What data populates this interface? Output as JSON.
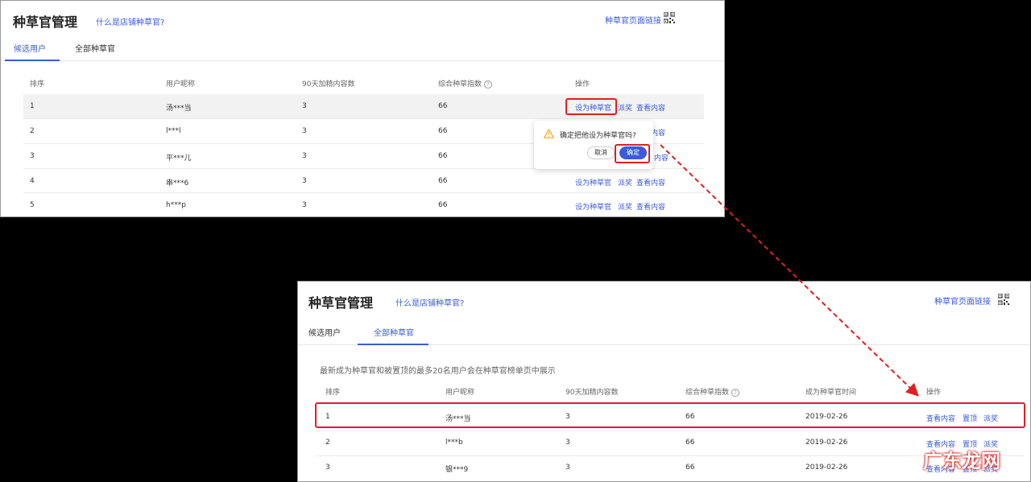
{
  "top": {
    "title": "种草官管理",
    "help_link": "什么是店铺种草官?",
    "page_link": "种草官页面链接",
    "tabs": [
      "候选用户",
      "全部种草官"
    ],
    "columns": [
      "排序",
      "用户昵称",
      "90天加精内容数",
      "综合种草指数",
      "操作"
    ],
    "rows": [
      {
        "rank": "1",
        "nick": "汤***当",
        "count": "3",
        "index": "66"
      },
      {
        "rank": "2",
        "nick": "l***l",
        "count": "3",
        "index": "66"
      },
      {
        "rank": "3",
        "nick": "平***儿",
        "count": "3",
        "index": "66"
      },
      {
        "rank": "4",
        "nick": "串***6",
        "count": "3",
        "index": "66"
      },
      {
        "rank": "5",
        "nick": "h***p",
        "count": "3",
        "index": "66"
      }
    ],
    "actions": {
      "set": "设为种草官",
      "award": "派奖",
      "view": "查看内容"
    },
    "partial_view": "内容",
    "partial_award": "派奖",
    "partial_view3": "内容",
    "popover": {
      "message": "确定把他设为种草官吗?",
      "cancel": "取消",
      "ok": "确定"
    }
  },
  "bottom": {
    "title": "种草官管理",
    "help_link": "什么是店铺种草官?",
    "page_link": "种草官页面链接",
    "tabs": [
      "候选用户",
      "全部种草官"
    ],
    "note": "最新成为种草官和被置顶的最多20名用户会在种草官榜单页中展示",
    "columns": [
      "排序",
      "用户昵称",
      "90天加精内容数",
      "综合种草指数",
      "成为种草官时间",
      "操作"
    ],
    "rows": [
      {
        "rank": "1",
        "nick": "汤***当",
        "count": "3",
        "index": "66",
        "date": "2019-02-26"
      },
      {
        "rank": "2",
        "nick": "l***b",
        "count": "3",
        "index": "66",
        "date": "2019-02-26"
      },
      {
        "rank": "3",
        "nick": "银***9",
        "count": "3",
        "index": "66",
        "date": "2019-02-26"
      }
    ],
    "actions": {
      "view": "查看内容",
      "pin": "置顶",
      "award": "派奖"
    }
  },
  "watermark": "广东龙网",
  "colors": {
    "accent": "#3b5bdb",
    "highlight": "#e02020"
  }
}
